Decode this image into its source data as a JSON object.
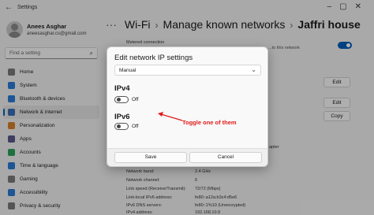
{
  "window": {
    "back_glyph": "←",
    "app_title": "Settings",
    "controls": "–▢✕"
  },
  "user": {
    "name": "Anees Asghar",
    "email": "aneesasghar.cs@gmail.com"
  },
  "search": {
    "placeholder": "Find a setting",
    "icon": "search-icon"
  },
  "sidebar": {
    "items": [
      {
        "label": "Home",
        "icon": "home-icon",
        "color": "#7a7a7a",
        "active": false
      },
      {
        "label": "System",
        "icon": "system-icon",
        "color": "#2b7bd6",
        "active": false
      },
      {
        "label": "Bluetooth & devices",
        "icon": "bluetooth-icon",
        "color": "#2b7bd6",
        "active": false
      },
      {
        "label": "Network & internet",
        "icon": "network-icon",
        "color": "#3a6fb5",
        "active": true
      },
      {
        "label": "Personalization",
        "icon": "brush-icon",
        "color": "#d9822b",
        "active": false
      },
      {
        "label": "Apps",
        "icon": "apps-icon",
        "color": "#5a5a8a",
        "active": false
      },
      {
        "label": "Accounts",
        "icon": "accounts-icon",
        "color": "#2ba35a",
        "active": false
      },
      {
        "label": "Time & language",
        "icon": "globe-icon",
        "color": "#2b7bd6",
        "active": false
      },
      {
        "label": "Gaming",
        "icon": "gaming-icon",
        "color": "#7a7a7a",
        "active": false
      },
      {
        "label": "Accessibility",
        "icon": "accessibility-icon",
        "color": "#2b7bd6",
        "active": false
      },
      {
        "label": "Privacy & security",
        "icon": "shield-icon",
        "color": "#7a7a7a",
        "active": false
      }
    ]
  },
  "breadcrumb": {
    "dots": "···",
    "sep": "›",
    "items": [
      "Wi-Fi",
      "Manage known networks"
    ],
    "current": "Jaffri house"
  },
  "background": {
    "metered_label": "Metered connection",
    "metered_desc": "...to this network",
    "edit_label": "Edit",
    "copy_label": "Copy",
    "adapter_text": "apter",
    "rows": [
      {
        "label": "Network band:",
        "value": "2.4 GHz"
      },
      {
        "label": "Network channel:",
        "value": "6"
      },
      {
        "label": "Link speed (Receive/Transmit):",
        "value": "72/72 (Mbps)"
      },
      {
        "label": "Link-local IPv6 address:",
        "value": "fe80::a12a:b3c4:d5e6"
      },
      {
        "label": "IPv6 DNS servers:",
        "value": "fe80::1%10 (Unencrypted)"
      },
      {
        "label": "IPv4 address:",
        "value": "192.168.10.9"
      }
    ]
  },
  "dialog": {
    "title": "Edit network IP settings",
    "mode_value": "Manual",
    "ipv4_label": "IPv4",
    "ipv4_state": "Off",
    "ipv6_label": "IPv6",
    "ipv6_state": "Off",
    "save_label": "Save",
    "cancel_label": "Cancel"
  },
  "annotation": {
    "text": "Toggle one of them",
    "color": "#e21b1b"
  }
}
